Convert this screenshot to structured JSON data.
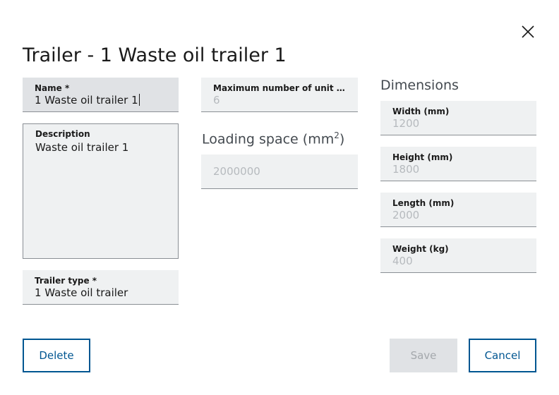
{
  "dialog": {
    "title": "Trailer - 1 Waste oil trailer 1",
    "close_icon": "close-icon"
  },
  "fields": {
    "name": {
      "label": "Name *",
      "value": "1 Waste oil trailer 1"
    },
    "description": {
      "label": "Description",
      "value": "Waste oil trailer 1"
    },
    "trailer_type": {
      "label": "Trailer type *",
      "value": "1 Waste oil trailer"
    },
    "max_units": {
      "label": "Maximum number of unit loa...",
      "value": "6"
    },
    "loading_space": {
      "heading": "Loading space (mm",
      "superscript": "2",
      "heading_close": ")",
      "value": "2000000"
    },
    "dimensions": {
      "heading": "Dimensions",
      "width": {
        "label": "Width (mm)",
        "value": "1200"
      },
      "height": {
        "label": "Height (mm)",
        "value": "1800"
      },
      "length": {
        "label": "Length (mm)",
        "value": "2000"
      },
      "weight": {
        "label": "Weight (kg)",
        "value": "400"
      }
    }
  },
  "buttons": {
    "delete": "Delete",
    "save": "Save",
    "cancel": "Cancel"
  },
  "colors": {
    "accent": "#005691",
    "field_bg": "#eff1f2",
    "disabled_text": "#b6babe"
  }
}
